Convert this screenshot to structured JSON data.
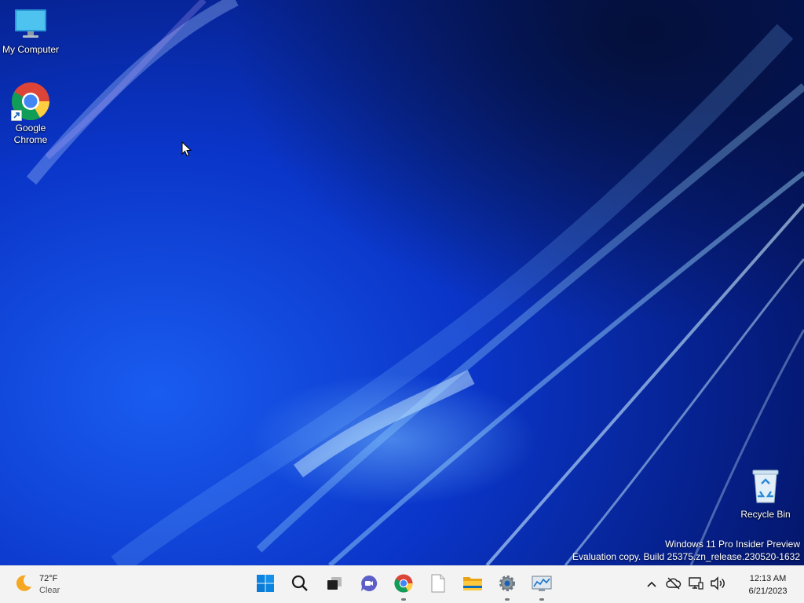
{
  "desktop": {
    "icons": [
      {
        "label": "My Computer",
        "icon": "monitor-icon"
      },
      {
        "label": "Google Chrome",
        "icon": "chrome-icon"
      },
      {
        "label": "Recycle Bin",
        "icon": "recycle-bin-icon"
      }
    ],
    "watermark": {
      "line1": "Windows 11 Pro Insider Preview",
      "line2": "Evaluation copy. Build 25375.zn_release.230520-1632"
    }
  },
  "taskbar": {
    "weather": {
      "temp": "72°F",
      "condition": "Clear",
      "icon": "moon-icon"
    },
    "apps": [
      {
        "name": "Start",
        "icon": "windows-start-icon",
        "running": false
      },
      {
        "name": "Search",
        "icon": "search-icon",
        "running": false
      },
      {
        "name": "Task View",
        "icon": "task-view-icon",
        "running": false
      },
      {
        "name": "Chat",
        "icon": "chat-icon",
        "running": false
      },
      {
        "name": "Google Chrome",
        "icon": "chrome-icon",
        "running": true
      },
      {
        "name": "Notepad",
        "icon": "document-icon",
        "running": false
      },
      {
        "name": "File Explorer",
        "icon": "folder-icon",
        "running": false
      },
      {
        "name": "Settings",
        "icon": "gear-icon",
        "running": true
      },
      {
        "name": "Performance Monitor",
        "icon": "monitor-chart-icon",
        "running": true
      }
    ],
    "tray": {
      "icons": [
        "chevron-up-icon",
        "onedrive-offline-icon",
        "network-icon",
        "volume-icon"
      ],
      "time": "12:13 AM",
      "date": "6/21/2023"
    }
  },
  "colors": {
    "taskbar_bg": "#f3f3f3",
    "accent": "#0067c0"
  }
}
